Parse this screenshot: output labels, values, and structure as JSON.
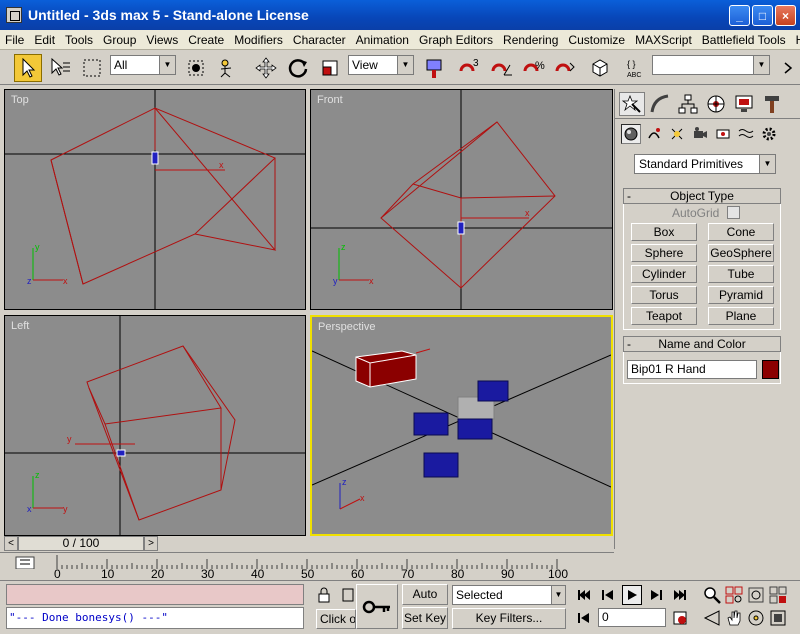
{
  "window": {
    "title": "Untitled - 3ds max 5 - Stand-alone License",
    "minimize": "_",
    "maximize": "□",
    "close": "×"
  },
  "menu": [
    "File",
    "Edit",
    "Tools",
    "Group",
    "Views",
    "Create",
    "Modifiers",
    "Character",
    "Animation",
    "Graph Editors",
    "Rendering",
    "Customize",
    "MAXScript",
    "Battlefield Tools",
    "Help"
  ],
  "toolbar": {
    "selection_filter": "All",
    "reference_coord": "View",
    "named_selection": ""
  },
  "viewports": {
    "top": {
      "label": "Top"
    },
    "front": {
      "label": "Front"
    },
    "left": {
      "label": "Left"
    },
    "perspective": {
      "label": "Perspective"
    }
  },
  "command_panel": {
    "category_dropdown": "Standard Primitives",
    "object_type_title": "Object Type",
    "autogrid_label": "AutoGrid",
    "primitives": [
      "Box",
      "Cone",
      "Sphere",
      "GeoSphere",
      "Cylinder",
      "Tube",
      "Torus",
      "Pyramid",
      "Teapot",
      "Plane"
    ],
    "name_color_title": "Name and Color",
    "object_name": "Bip01 R Hand",
    "object_color": "#8b0000"
  },
  "timeline": {
    "frame_display": "0 / 100",
    "ticks": [
      "0",
      "10",
      "20",
      "30",
      "40",
      "50",
      "60",
      "70",
      "80",
      "90",
      "100"
    ]
  },
  "status": {
    "listener_output": "\"--- Done bonesys() ---\"",
    "prompt_text": "Click or",
    "auto_key": "Auto Key",
    "set_key": "Set Key",
    "key_mode": "Selected",
    "key_filters": "Key Filters...",
    "current_frame": "0"
  },
  "colors": {
    "accent_yellow": "#f3c838",
    "viewport_bg": "#8c8c8c",
    "wire_red": "#b01010",
    "active_viewport": "#f0e000"
  }
}
